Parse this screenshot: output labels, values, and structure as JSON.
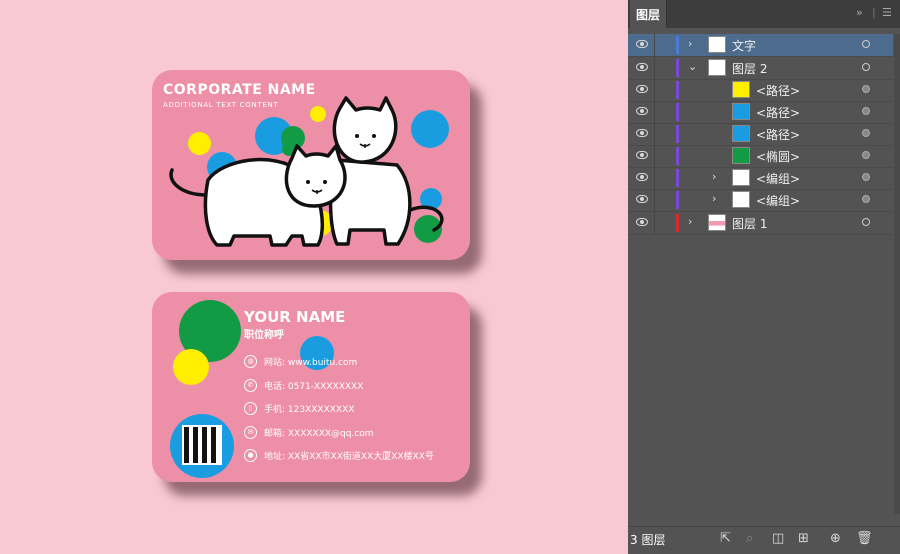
{
  "front_card": {
    "corporate_name": "CORPORATE NAME",
    "additional_text": "ADDITIONAL TEXT CONTENT"
  },
  "back_card": {
    "name": "YOUR NAME",
    "job_title": "职位称呼",
    "contacts": [
      {
        "icon": "globe-icon",
        "text": "网站: www.buitu.com"
      },
      {
        "icon": "phone-icon",
        "text": "电话: 0571-XXXXXXXX"
      },
      {
        "icon": "mobile-icon",
        "text": "手机: 123XXXXXXXX"
      },
      {
        "icon": "mail-icon",
        "text": "邮箱: XXXXXXX@qq.com"
      },
      {
        "icon": "location-icon",
        "text": "地址: XX省XX市XX街道XX大厦XX楼XX号"
      }
    ]
  },
  "layers_panel": {
    "tab_title": "图层",
    "layers": [
      {
        "name": "文字",
        "color": "#4a7bd6",
        "expanded": false
      },
      {
        "name": "图层 2",
        "color": "#7a4ad6",
        "expanded": true
      },
      {
        "name": "<路径>",
        "color": "#7a4ad6",
        "swatch": "#ffee00"
      },
      {
        "name": "<路径>",
        "color": "#7a4ad6",
        "swatch": "#1a9de0"
      },
      {
        "name": "<路径>",
        "color": "#7a4ad6",
        "swatch": "#1a9de0"
      },
      {
        "name": "<椭圆>",
        "color": "#7a4ad6",
        "swatch": "#139a45"
      },
      {
        "name": "<编组>",
        "color": "#7a4ad6",
        "expanded": false
      },
      {
        "name": "<编组>",
        "color": "#7a4ad6",
        "expanded": false
      },
      {
        "name": "图层 1",
        "color": "#d62b2b",
        "expanded": false
      }
    ],
    "layer_count": "3 图层"
  },
  "colors": {
    "background": "#f9c9d3",
    "card": "#ee8fa8",
    "blue": "#1a9de0",
    "green": "#139a45",
    "yellow": "#ffee00"
  }
}
